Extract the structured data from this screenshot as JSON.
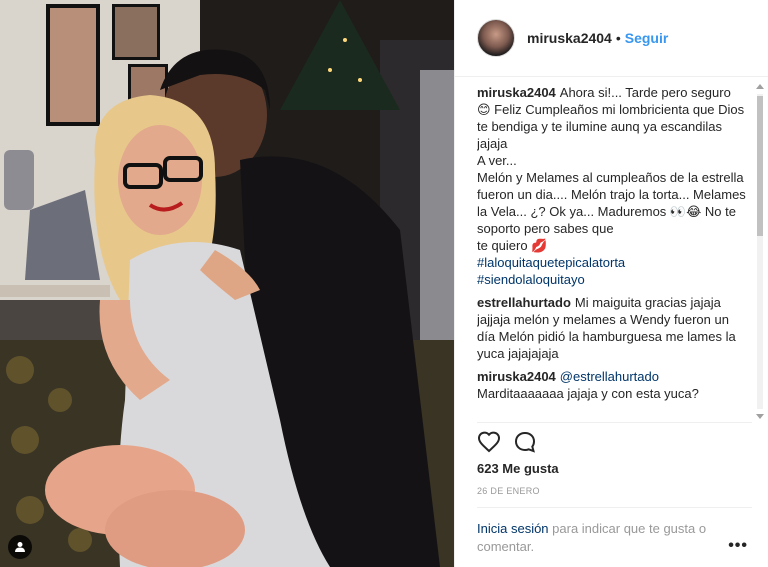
{
  "post": {
    "username": "miruska2404",
    "separator": "•",
    "follow_label": "Seguir",
    "likes": "623 Me gusta",
    "date": "26 DE ENERO",
    "login_link": "Inicia sesión",
    "login_text": " para indicar que te gusta o comentar.",
    "more_label": "•••"
  },
  "comments": [
    {
      "user": "miruska2404",
      "text": "Ahora si!... Tarde pero seguro 😊 Feliz Cumpleaños mi lombricienta que Dios te bendiga y te ilumine aunq ya escandilas jajaja\nA ver...\nMelón y Melames al cumpleaños de la estrella fueron un dia.... Melón trajo la torta... Melames la Vela... ¿? Ok ya... Maduremos 👀😂 No te soporto pero sabes que\nte quiero 💋",
      "hashtags": [
        "#laloquitaquetepicalatorta",
        "#siendolaloquitayo"
      ]
    },
    {
      "user": "estrellahurtado",
      "text": "Mi maiguita gracias jajaja jajjaja melón y melames a Wendy fueron un día Melón pidió la hamburguesa me lames la yuca jajajajaja"
    },
    {
      "user": "miruska2404",
      "mention": "@estrellahurtado",
      "text": "Marditaaaaaaa jajaja y con esta yuca?"
    }
  ],
  "icons": {
    "like": "heart-icon",
    "comment": "comment-icon",
    "tag": "user-tag-icon",
    "more": "more-options-icon"
  },
  "colors": {
    "link": "#3897f0",
    "hashtag": "#003569",
    "muted": "#999999"
  }
}
